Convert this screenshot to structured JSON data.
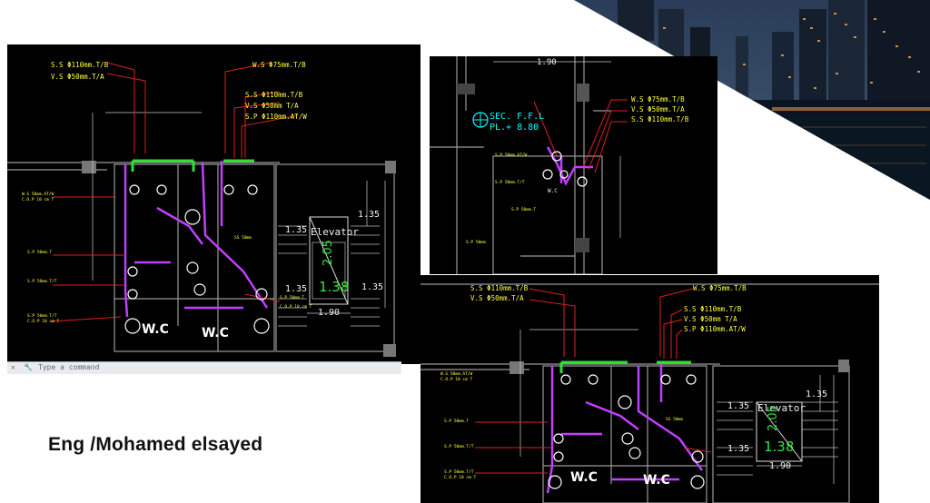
{
  "caption": "Eng /Mohamed elsayed",
  "command_bar": {
    "prompt": "Type a command"
  },
  "drawing_main": {
    "labels": {
      "ss": "S.S Φ110mm.T/B",
      "vs": "V.S Φ50mm.T/A",
      "ws_top": "W.S Φ75mm.T/B",
      "ss2": "S.S Φ110mm.T/B",
      "vs2": "V.S Φ50mm T/A",
      "sp": "S.P Φ110mm.AT/W",
      "wc1": "W.C",
      "wc2": "W.C",
      "elevator": "Elevator",
      "dim_135a": "1.35",
      "dim_135b": "1.35",
      "dim_135c": "1.35",
      "dim_135d": "1.35",
      "dim_190": "1.90",
      "dim_138": "1.38",
      "dim_205": "2.05"
    }
  },
  "drawing_top_right": {
    "labels": {
      "dim_190": "1.90",
      "sec": "SEC. F.F.L",
      "pl": "PL.+ 8.80",
      "ws": "W.S Φ75mm.T/B",
      "vs": "V.S Φ50mm.T/A",
      "ss": "S.S Φ110mm.T/B",
      "wc_small": "W.C"
    }
  },
  "drawing_bottom_right": {
    "labels": {
      "ss": "S.S Φ110mm.T/B",
      "vs": "V.S Φ50mm.T/A",
      "ws_top": "W.S Φ75mm.T/B",
      "ss2": "S.S Φ110mm.T/B",
      "vs2": "V.S Φ50mm T/A",
      "sp": "S.P Φ110mm.AT/W",
      "wc1": "W.C",
      "wc2": "W.C",
      "elevator": "Elevator",
      "dim_135a": "1.35",
      "dim_135b": "1.35",
      "dim_135c": "1.35",
      "dim_190": "1.90",
      "dim_138": "1.38",
      "dim_205": "2.05"
    }
  },
  "colors": {
    "pipe_magenta": "#c040ff",
    "pipe_green": "#30e030",
    "pipe_red": "#e02020",
    "label_yellow": "#ffff3c",
    "cyan": "#00ffff"
  }
}
